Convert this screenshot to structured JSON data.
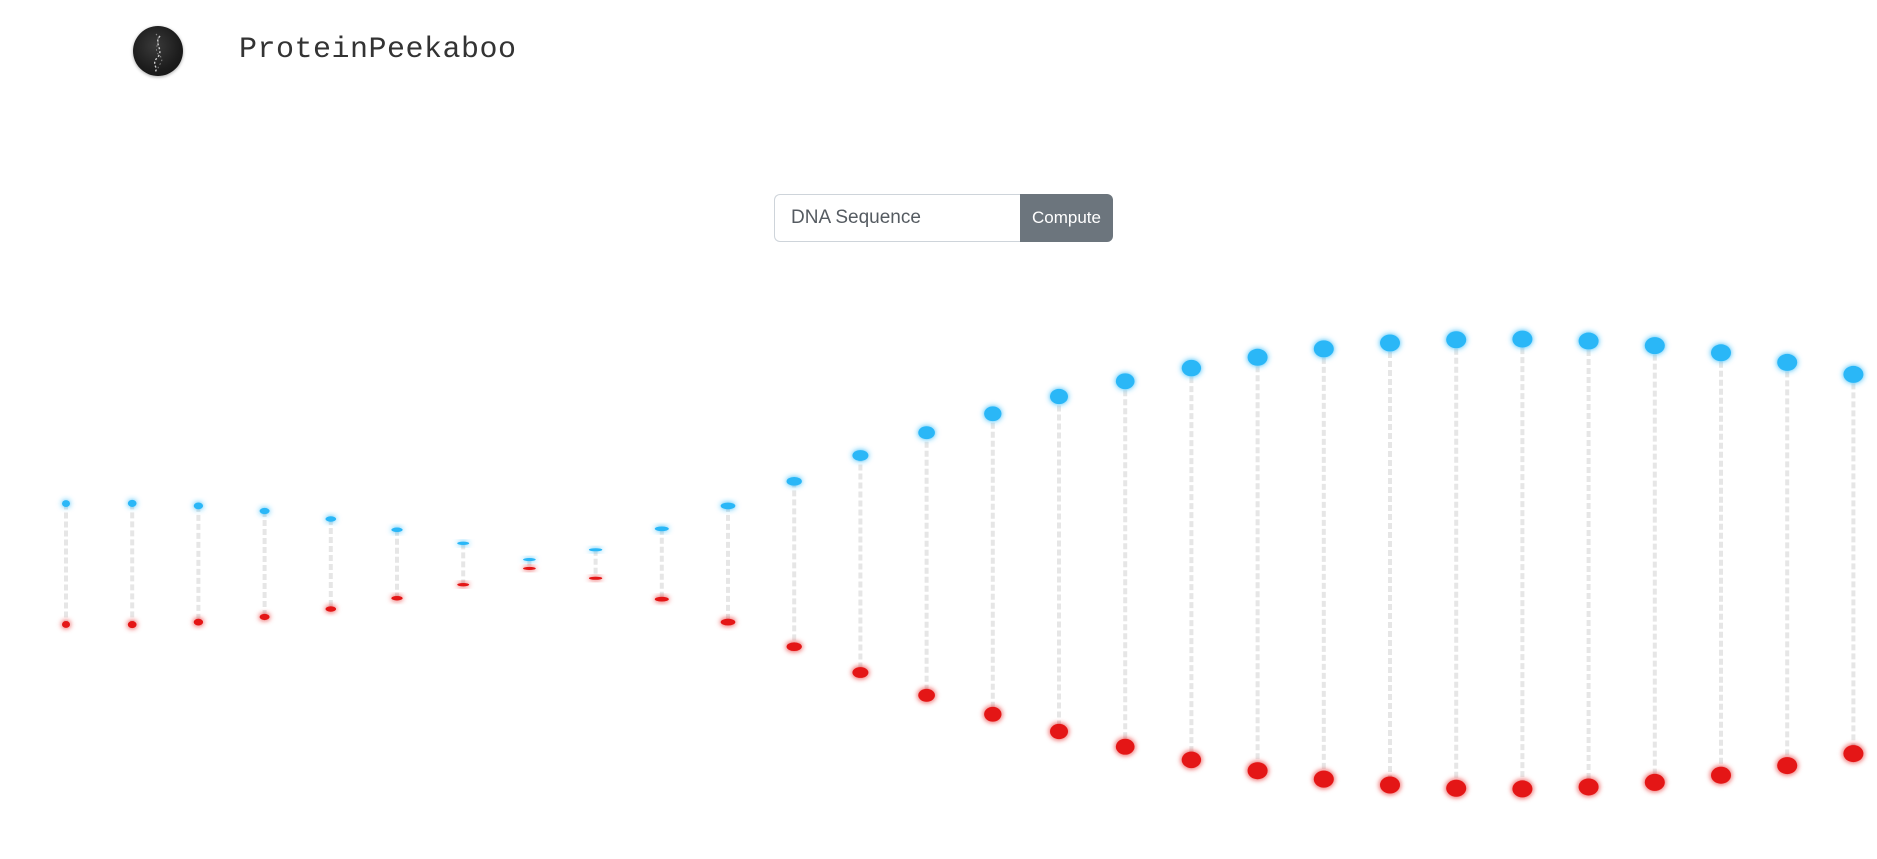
{
  "navbar": {
    "brand": "ProteinPeekaboo",
    "logo_icon": "dna-helix-icon"
  },
  "form": {
    "input_placeholder": "DNA Sequence",
    "input_value": "",
    "button_label": "Compute"
  },
  "colors": {
    "strand_a": "#2bb7f7",
    "strand_b": "#e41414",
    "rung": "#e6e6e6",
    "button_bg": "#6c757d",
    "brand_text": "#333333"
  },
  "helix": {
    "rung_count": 28
  }
}
